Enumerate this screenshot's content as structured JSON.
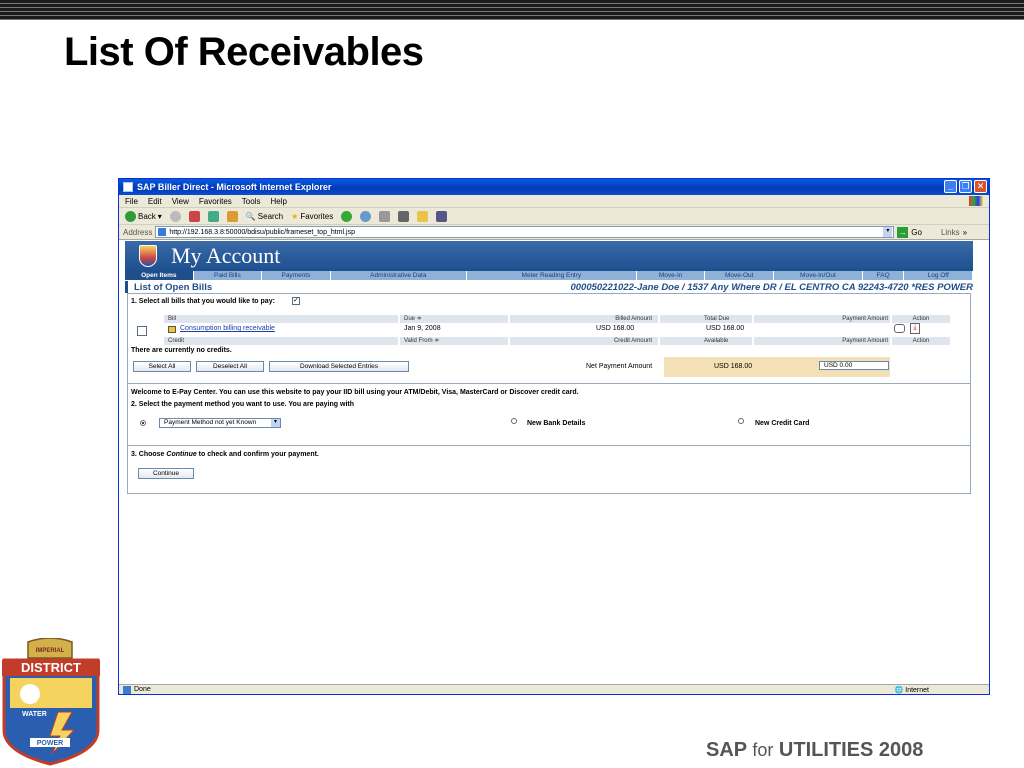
{
  "slide": {
    "title": "List Of Receivables",
    "footer_sap": "SAP",
    "footer_for": "for",
    "footer_rest": "UTILITIES 2008",
    "logo_text_top": "DISTRICT",
    "logo_text_mid": "WATER",
    "logo_text_bottom": "POWER",
    "logo_banner": "IMPERIAL"
  },
  "window": {
    "title": "SAP Biller Direct - Microsoft Internet Explorer",
    "menu": [
      "File",
      "Edit",
      "View",
      "Favorites",
      "Tools",
      "Help"
    ],
    "toolbar": {
      "back": "Back",
      "search": "Search",
      "favorites": "Favorites"
    },
    "address_label": "Address",
    "address_url": "http://192.168.3.8:50000/bdisu/public/frameset_top_html.jsp",
    "go_label": "Go",
    "links_label": "Links",
    "status_done": "Done",
    "status_zone": "Internet"
  },
  "page": {
    "header_title": "My Account",
    "nav_tabs": [
      "Open Items",
      "Paid Bills",
      "Payments",
      "Administrative Data",
      "Meter Reading Entry",
      "Move-In",
      "Move-Out",
      "Move-In/Out",
      "FAQ",
      "Log Off"
    ],
    "active_tab": "Open Items",
    "list_title": "List of Open Bills",
    "account_info": "000050221022-Jane Doe / 1537 Any Where DR / EL CENTRO CA 92243-4720 *RES POWER",
    "step1": "1. Select all bills that you would like to pay:",
    "bill_headers": {
      "bill": "Bill",
      "due": "Due",
      "billed_amount": "Billed Amount",
      "total_due": "Total Due",
      "payment_amount": "Payment Amount",
      "action": "Action"
    },
    "bill_row": {
      "name": "Consumption billing receivable",
      "due": "Jan 9, 2008",
      "billed_amount": "USD 168.00",
      "total_due": "USD 168.00"
    },
    "credit_headers": {
      "credit": "Credit",
      "valid_from": "Valid From",
      "credit_amount": "Credit Amount",
      "available": "Available",
      "payment_amount": "Payment Amount",
      "action": "Action"
    },
    "no_credits": "There are currently no credits.",
    "btn_select_all": "Select All",
    "btn_deselect_all": "Deselect All",
    "btn_download": "Download Selected Entries",
    "net_payment_label": "Net Payment Amount",
    "net_payment_value": "USD 168.00",
    "payment_input_value": "USD 0.00",
    "welcome": "Welcome to E-Pay Center. You can use this website to pay your IID bill using your ATM/Debit, Visa, MasterCard or Discover credit card.",
    "step2": "2. Select the payment method you want to use. You are paying with",
    "payment_method_select": "Payment Method not yet Known",
    "radio_new_bank": "New Bank Details",
    "radio_new_card": "New Credit Card",
    "step3_prefix": "3. Choose ",
    "step3_em": "Continue",
    "step3_suffix": " to check and confirm your payment.",
    "btn_continue": "Continue"
  }
}
